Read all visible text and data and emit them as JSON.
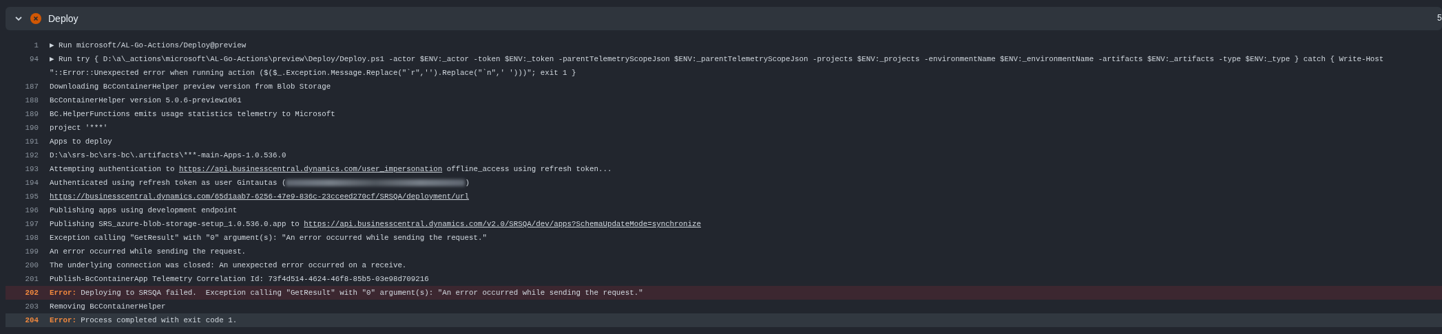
{
  "step": {
    "title": "Deploy",
    "failed": true,
    "expanded": true,
    "duration": "5"
  },
  "lines": [
    {
      "number": "1",
      "error": false,
      "selected": false,
      "segments": [
        {
          "kind": "text",
          "text": "▶ Run microsoft/AL-Go-Actions/Deploy@preview"
        }
      ]
    },
    {
      "number": "94",
      "error": false,
      "selected": false,
      "segments": [
        {
          "kind": "text",
          "text": "▶ Run try { D:\\a\\_actions\\microsoft\\AL-Go-Actions\\preview\\Deploy/Deploy.ps1 -actor $ENV:_actor -token $ENV:_token -parentTelemetryScopeJson $ENV:_parentTelemetryScopeJson -projects $ENV:_projects -environmentName $ENV:_environmentName -artifacts $ENV:_artifacts -type $ENV:_type } catch { Write-Host"
        },
        {
          "kind": "break"
        },
        {
          "kind": "text",
          "text": "\"::Error::Unexpected error when running action ($($_.Exception.Message.Replace(\"`r\",'').Replace(\"`n\",' ')))\"; exit 1 }"
        }
      ]
    },
    {
      "number": "187",
      "error": false,
      "selected": false,
      "segments": [
        {
          "kind": "text",
          "text": "Downloading BcContainerHelper preview version from Blob Storage"
        }
      ]
    },
    {
      "number": "188",
      "error": false,
      "selected": false,
      "segments": [
        {
          "kind": "text",
          "text": "BcContainerHelper version 5.0.6-preview1061"
        }
      ]
    },
    {
      "number": "189",
      "error": false,
      "selected": false,
      "segments": [
        {
          "kind": "text",
          "text": "BC.HelperFunctions emits usage statistics telemetry to Microsoft"
        }
      ]
    },
    {
      "number": "190",
      "error": false,
      "selected": false,
      "segments": [
        {
          "kind": "text",
          "text": "project '***'"
        }
      ]
    },
    {
      "number": "191",
      "error": false,
      "selected": false,
      "segments": [
        {
          "kind": "text",
          "text": "Apps to deploy"
        }
      ]
    },
    {
      "number": "192",
      "error": false,
      "selected": false,
      "segments": [
        {
          "kind": "text",
          "text": "D:\\a\\srs-bc\\srs-bc\\.artifacts\\***-main-Apps-1.0.536.0"
        }
      ]
    },
    {
      "number": "193",
      "error": false,
      "selected": false,
      "segments": [
        {
          "kind": "text",
          "text": "Attempting authentication to "
        },
        {
          "kind": "link",
          "text": "https://api.businesscentral.dynamics.com/user_impersonation"
        },
        {
          "kind": "text",
          "text": " offline_access using refresh token..."
        }
      ]
    },
    {
      "number": "194",
      "error": false,
      "selected": false,
      "segments": [
        {
          "kind": "text",
          "text": "Authenticated using refresh token as user Gintautas ("
        },
        {
          "kind": "redacted"
        },
        {
          "kind": "text",
          "text": ")"
        }
      ]
    },
    {
      "number": "195",
      "error": false,
      "selected": false,
      "segments": [
        {
          "kind": "link",
          "text": "https://businesscentral.dynamics.com/65d1aab7-6256-47e9-836c-23cceed270cf/SRSQA/deployment/url"
        }
      ]
    },
    {
      "number": "196",
      "error": false,
      "selected": false,
      "segments": [
        {
          "kind": "text",
          "text": "Publishing apps using development endpoint"
        }
      ]
    },
    {
      "number": "197",
      "error": false,
      "selected": false,
      "segments": [
        {
          "kind": "text",
          "text": "Publishing SRS_azure-blob-storage-setup_1.0.536.0.app to "
        },
        {
          "kind": "link",
          "text": "https://api.businesscentral.dynamics.com/v2.0/SRSQA/dev/apps?SchemaUpdateMode=synchronize"
        }
      ]
    },
    {
      "number": "198",
      "error": false,
      "selected": false,
      "segments": [
        {
          "kind": "text",
          "text": "Exception calling \"GetResult\" with \"0\" argument(s): \"An error occurred while sending the request.\""
        }
      ]
    },
    {
      "number": "199",
      "error": false,
      "selected": false,
      "segments": [
        {
          "kind": "text",
          "text": "An error occurred while sending the request."
        }
      ]
    },
    {
      "number": "200",
      "error": false,
      "selected": false,
      "segments": [
        {
          "kind": "text",
          "text": "The underlying connection was closed: An unexpected error occurred on a receive."
        }
      ]
    },
    {
      "number": "201",
      "error": false,
      "selected": false,
      "segments": [
        {
          "kind": "text",
          "text": "Publish-BcContainerApp Telemetry Correlation Id: 73f4d514-4624-46f8-85b5-03e98d709216"
        }
      ]
    },
    {
      "number": "202",
      "error": true,
      "selected": false,
      "segments": [
        {
          "kind": "label",
          "text": "Error:"
        },
        {
          "kind": "text",
          "text": " Deploying to SRSQA failed.  Exception calling \"GetResult\" with \"0\" argument(s): \"An error occurred while sending the request.\""
        }
      ]
    },
    {
      "number": "203",
      "error": false,
      "selected": false,
      "segments": [
        {
          "kind": "text",
          "text": "Removing BcContainerHelper"
        }
      ]
    },
    {
      "number": "204",
      "error": true,
      "selected": true,
      "segments": [
        {
          "kind": "label",
          "text": "Error:"
        },
        {
          "kind": "text",
          "text": " Process completed with exit code 1."
        }
      ]
    }
  ]
}
